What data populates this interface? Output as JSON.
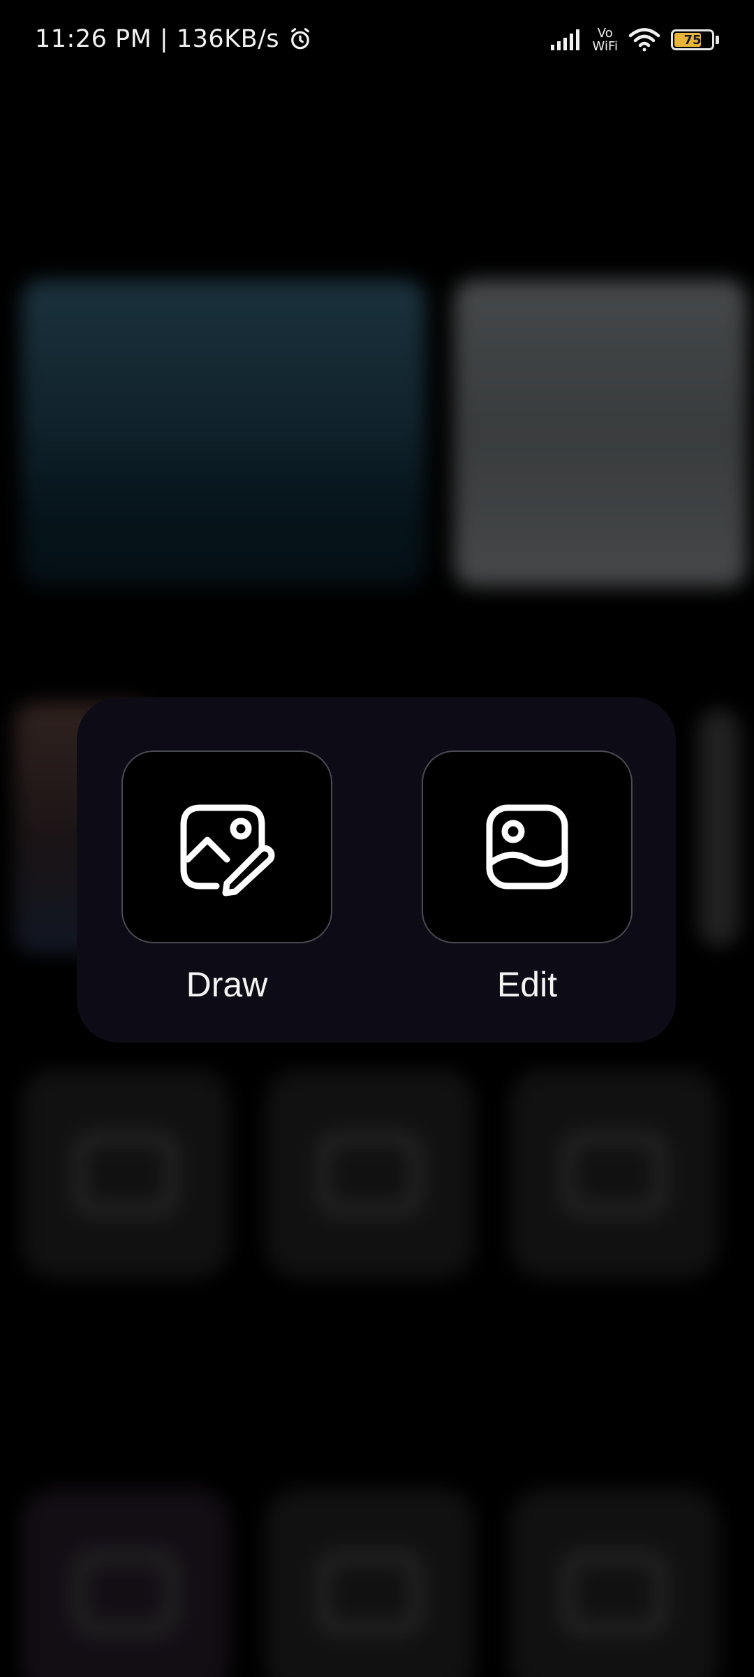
{
  "status_bar": {
    "time_speed": "11:26 PM | 136KB/s",
    "vowifi_top": "Vo",
    "vowifi_bottom": "WiFi",
    "battery_level": "75",
    "battery_percent": 75,
    "battery_color": "#e8b43a"
  },
  "background": {
    "app_title": "",
    "sections": [
      "",
      "",
      "",
      ""
    ],
    "tiles_row1_labels": [
      "",
      "",
      ""
    ]
  },
  "popup": {
    "actions": [
      {
        "label": "Draw",
        "icon": "image-edit-icon"
      },
      {
        "label": "Edit",
        "icon": "image-icon"
      }
    ]
  },
  "colors": {
    "popup_bg": "#0d0c16",
    "tile_bg": "#000000",
    "tile_border": "#4a4a52",
    "accent_blue": "#1e5bd6"
  }
}
